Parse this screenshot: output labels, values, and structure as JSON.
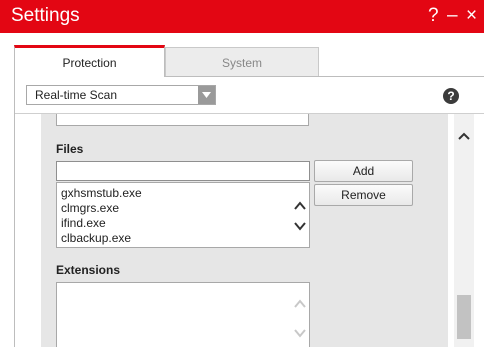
{
  "window": {
    "title": "Settings",
    "help_glyph": "?",
    "minimize_glyph": "–",
    "close_glyph": "×",
    "accent_color": "#e30613"
  },
  "tabs": [
    {
      "label": "Protection",
      "active": true
    },
    {
      "label": "System",
      "active": false
    }
  ],
  "section_select": {
    "value": "Real-time Scan",
    "help_glyph": "?"
  },
  "files": {
    "label": "Files",
    "input_value": "",
    "add_label": "Add",
    "remove_label": "Remove",
    "items": [
      "gxhsmstub.exe",
      "clmgrs.exe",
      "ifind.exe",
      "clbackup.exe"
    ]
  },
  "extensions": {
    "label": "Extensions",
    "items": []
  },
  "icons": {
    "dropdown": "chevron-down-icon",
    "scroll_up": "chevron-up-icon",
    "scroll_down": "chevron-down-icon",
    "help": "help-circle-icon"
  }
}
